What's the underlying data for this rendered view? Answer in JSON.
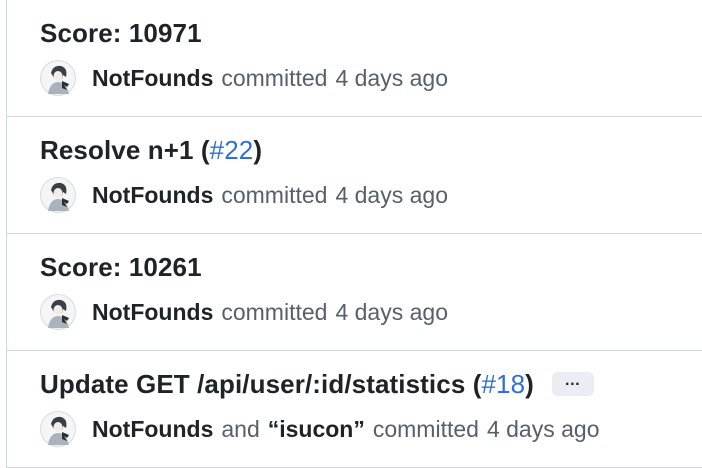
{
  "commits": [
    {
      "title": "Score: 10971",
      "author": "NotFounds",
      "committed_text": "committed",
      "time": "4 days ago"
    },
    {
      "title": "Resolve n+1 (",
      "pr": "#22",
      "title_close": ")",
      "author": "NotFounds",
      "committed_text": "committed",
      "time": "4 days ago"
    },
    {
      "title": "Score: 10261",
      "author": "NotFounds",
      "committed_text": "committed",
      "time": "4 days ago"
    },
    {
      "title": "Update GET /api/user/:id/statistics (",
      "pr": "#18",
      "title_close": ")",
      "ellipsis": "…",
      "author": "NotFounds",
      "and_text": "and",
      "coauthor": "“isucon”",
      "committed_text": "committed",
      "time": "4 days ago"
    }
  ],
  "icons": {
    "avatar": "avatar-icon",
    "expand": "ellipsis-icon"
  },
  "colors": {
    "link": "#2f6fd6",
    "muted": "#57606a",
    "text": "#1f2328",
    "border": "#d0d7de",
    "button_bg": "#eaeef2"
  }
}
